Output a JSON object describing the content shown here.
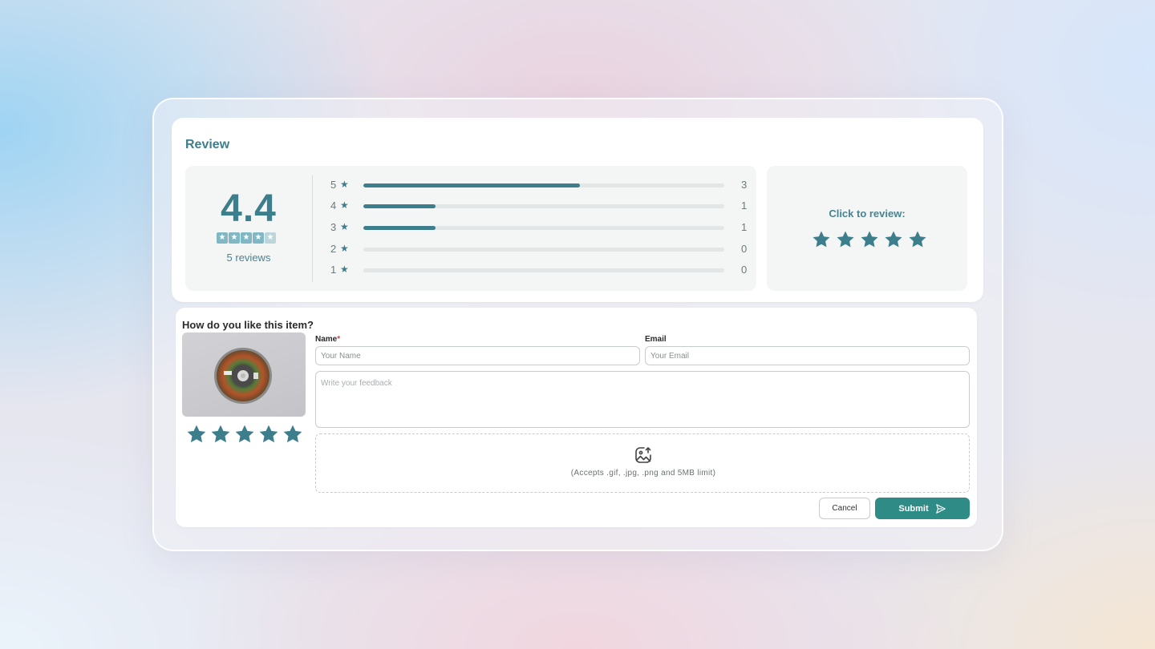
{
  "colors": {
    "accent": "#3d7e8c",
    "submit": "#2e8b86",
    "required": "#d23f4a"
  },
  "summary": {
    "title": "Review",
    "average": "4.4",
    "average_stars_filled": 4.4,
    "review_count_label": "5 reviews",
    "distribution": [
      {
        "stars": "5",
        "count": "3",
        "fraction": 0.6
      },
      {
        "stars": "4",
        "count": "1",
        "fraction": 0.2
      },
      {
        "stars": "3",
        "count": "1",
        "fraction": 0.2
      },
      {
        "stars": "2",
        "count": "0",
        "fraction": 0
      },
      {
        "stars": "1",
        "count": "0",
        "fraction": 0
      }
    ],
    "cta_label": "Click to review:",
    "cta_star_count": 5
  },
  "form": {
    "question": "How do you like this item?",
    "item_rating": 5,
    "name_label": "Name",
    "name_required_mark": "*",
    "name_placeholder": "Your Name",
    "email_label": "Email",
    "email_placeholder": "Your Email",
    "feedback_placeholder": "Write your feedback",
    "upload_icon": "image-upload-icon",
    "upload_hint": "(Accepts .gif, .jpg, .png and 5MB limit)",
    "cancel_label": "Cancel",
    "submit_label": "Submit",
    "submit_icon": "send-icon"
  }
}
